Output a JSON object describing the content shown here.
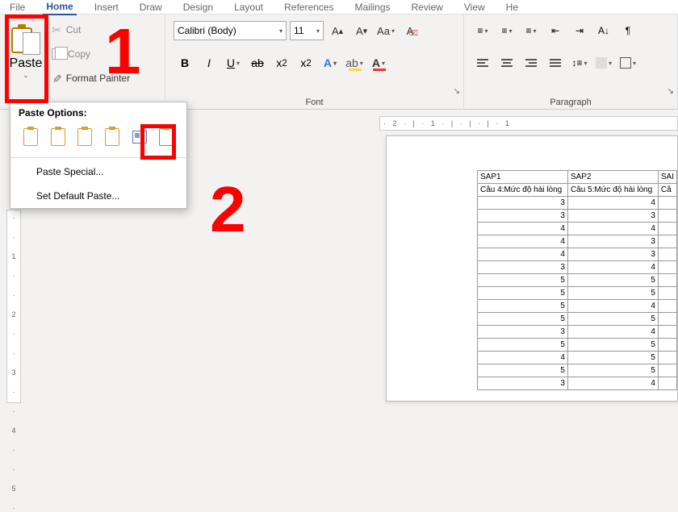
{
  "tabs": {
    "file": "File",
    "home": "Home",
    "insert": "Insert",
    "draw": "Draw",
    "design": "Design",
    "layout": "Layout",
    "references": "References",
    "mailings": "Mailings",
    "review": "Review",
    "view": "View",
    "help": "He"
  },
  "clipboard": {
    "paste": "Paste",
    "cut": "Cut",
    "copy": "Copy",
    "format_painter": "Format Painter"
  },
  "paste_options": {
    "title": "Paste Options:",
    "special": "Paste Special...",
    "default": "Set Default Paste..."
  },
  "font": {
    "name": "Calibri (Body)",
    "size": "11",
    "grow": "A▴",
    "shrink": "A▾",
    "case": "Aa",
    "group_label": "Font"
  },
  "para": {
    "group_label": "Paragraph"
  },
  "ruler_h": "· 2 · | · 1 · | · | · | · 1",
  "ruler_v": [
    "·",
    "·",
    "1",
    "·",
    "·",
    "2",
    "·",
    "·",
    "3",
    "·",
    "·",
    "4",
    "·",
    "·",
    "5",
    "·"
  ],
  "annot": {
    "one": "1",
    "two": "2"
  },
  "table": {
    "h1": "SAP1",
    "h2": "SAP2",
    "h3": "SAI",
    "sub1a": "Câu 4:",
    "sub1b": "Mức độ hài lòng",
    "sub2a": "Câu 5:",
    "sub2b": "Mức độ hài lòng",
    "sub3a": "Câ",
    "rows": [
      [
        "3",
        "4"
      ],
      [
        "3",
        "3"
      ],
      [
        "4",
        "4"
      ],
      [
        "4",
        "3"
      ],
      [
        "4",
        "3"
      ],
      [
        "3",
        "4"
      ],
      [
        "5",
        "5"
      ],
      [
        "5",
        "5"
      ],
      [
        "5",
        "4"
      ],
      [
        "5",
        "5"
      ],
      [
        "3",
        "4"
      ],
      [
        "5",
        "5"
      ],
      [
        "4",
        "5"
      ],
      [
        "5",
        "5"
      ],
      [
        "3",
        "4"
      ]
    ]
  }
}
